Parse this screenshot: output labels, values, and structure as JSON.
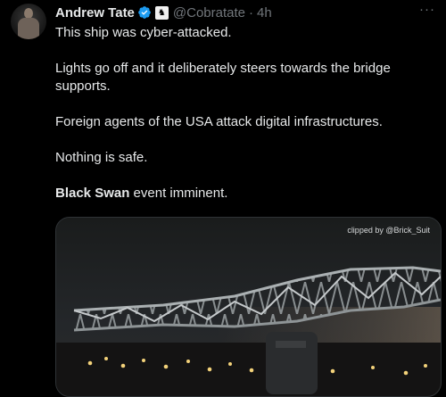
{
  "author": {
    "name": "Andrew Tate",
    "handle": "@Cobratate",
    "separator": "·",
    "time": "4h",
    "verified_color": "#1d9bf0",
    "affiliation_icon": "chess-knight-badge-icon"
  },
  "more_label": "···",
  "tweet": {
    "lines": [
      "This ship was cyber-attacked.",
      "Lights go off and it deliberately steers towards the bridge supports.",
      "Foreign agents of the USA attack digital infrastructures.",
      "Nothing is safe."
    ],
    "last_bold": "Black Swan",
    "last_rest": " event imminent."
  },
  "media": {
    "clip_credit": "clipped by @Brick_Suit"
  },
  "colors": {
    "background": "#000000",
    "text": "#e7e9ea",
    "muted": "#71767b",
    "accent": "#1d9bf0"
  }
}
